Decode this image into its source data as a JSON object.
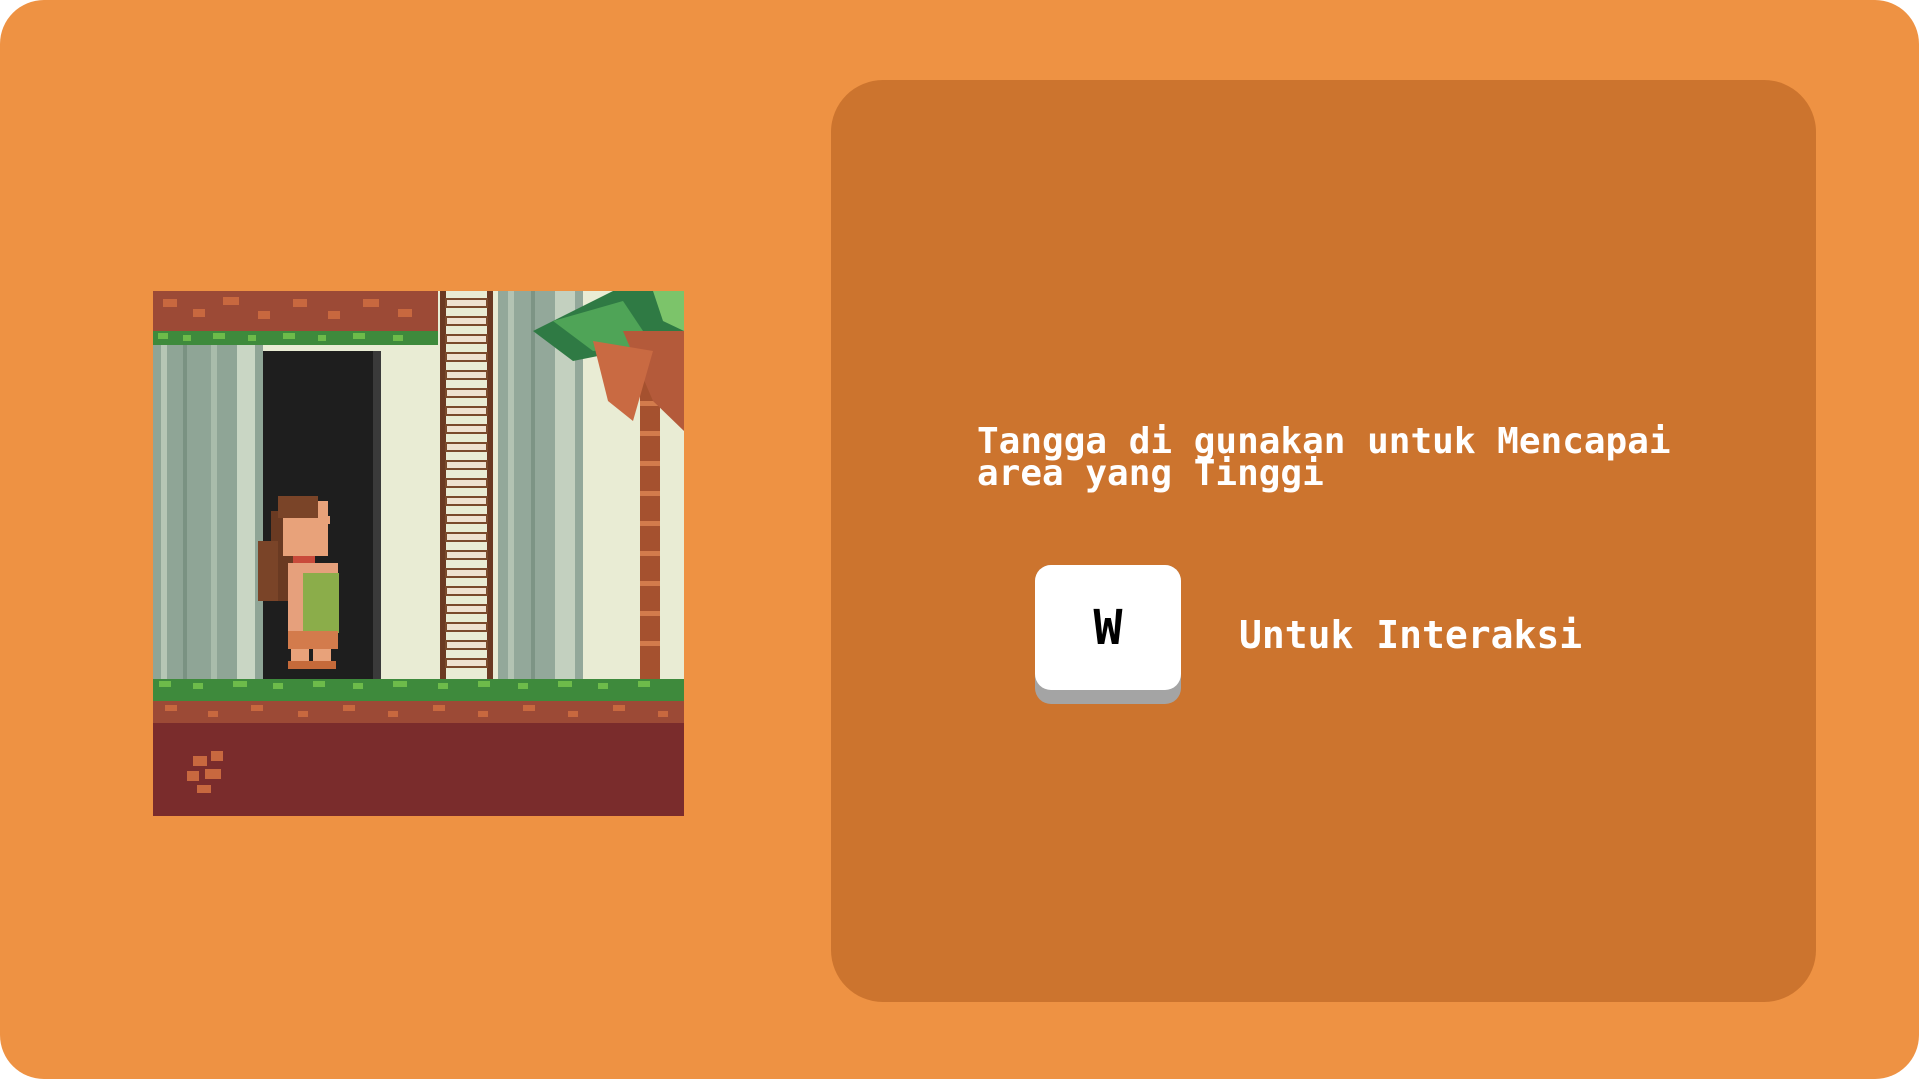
{
  "tutorial": {
    "tip_text": "Tangga di gunakan untuk Mencapai area yang Tinggi",
    "key_label": "W",
    "action_text": "Untuk Interaksi"
  },
  "colors": {
    "background": "#ee9243",
    "panel": "#cc742e",
    "text": "#ffffff",
    "key_face": "#ffffff",
    "key_shadow": "#a4a4a4"
  },
  "scene": {
    "character": "girl-character",
    "objects": [
      "ladder",
      "palm-tree",
      "doorway",
      "grass-ground",
      "dirt-ceiling"
    ]
  }
}
